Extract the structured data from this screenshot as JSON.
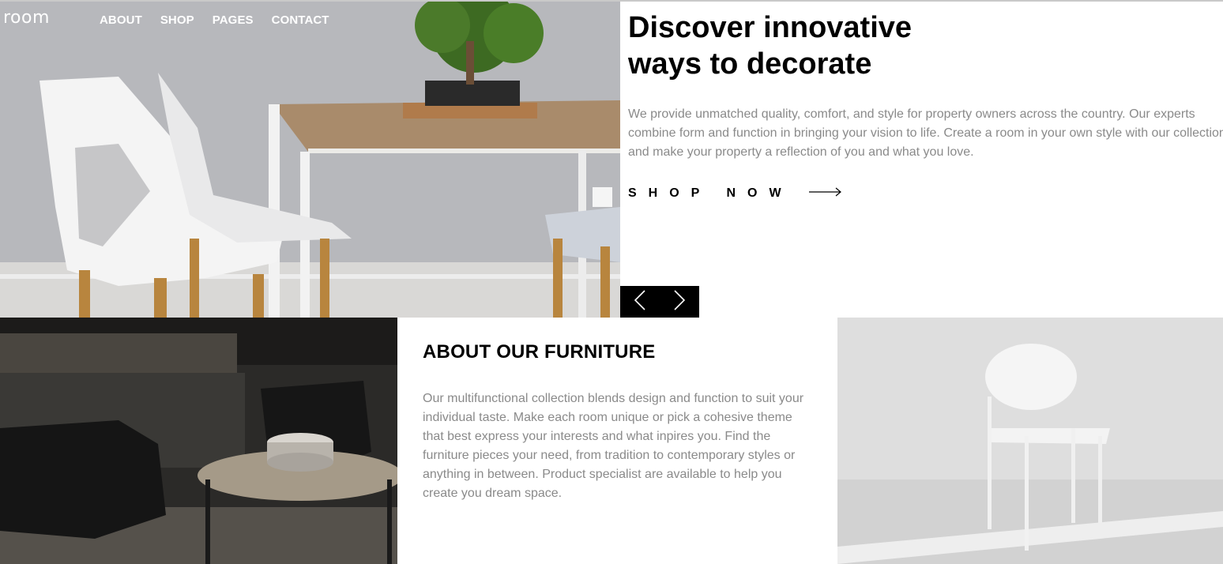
{
  "brand": {
    "logo_text": "room"
  },
  "nav": {
    "items": [
      "ABOUT",
      "SHOP",
      "PAGES",
      "CONTACT"
    ]
  },
  "hero": {
    "title_line1": "Discover innovative",
    "title_line2": "ways to decorate",
    "description_lines": [
      "We provide unmatched quality, comfort, and style for property owners across the country. Our experts",
      "combine form and function in bringing your vision to life. Create a room in your own style with our collection",
      "and make your property a reflection of you and what you love."
    ],
    "cta_label": "SHOP NOW",
    "cta_icon": "arrow-right-icon",
    "slider": {
      "prev_icon": "chevron-left-icon",
      "next_icon": "chevron-right-icon"
    }
  },
  "about": {
    "title": "ABOUT OUR FURNITURE",
    "description_lines": [
      "Our multifunctional collection blends design and function to suit your",
      "individual taste. Make each room unique or pick a cohesive theme",
      "that best express your interests and what inpires you. Find the",
      "furniture pieces your need, from tradition to contemporary styles or",
      "anything in between. Product specialist are available to help you",
      "create you dream space."
    ]
  },
  "colors": {
    "text_primary": "#000000",
    "text_muted": "#8a8a8a",
    "background": "#ffffff",
    "slider_bg": "#000000"
  }
}
